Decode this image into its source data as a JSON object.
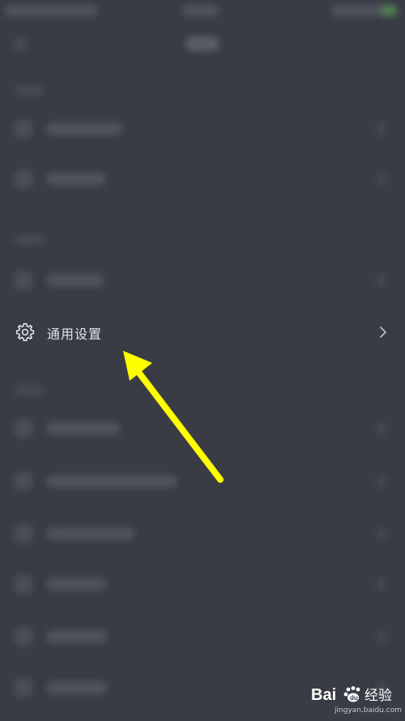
{
  "settings_item": {
    "label": "通用设置",
    "icon": "gear-icon",
    "chevron": "chevron-right-icon"
  },
  "annotation": {
    "type": "arrow",
    "color": "#ffff00"
  },
  "watermark": {
    "brand": "Baidu 经验",
    "url": "jingyan.baidu.com"
  },
  "colors": {
    "background": "#3a3c45",
    "text": "#e2e3e8"
  }
}
